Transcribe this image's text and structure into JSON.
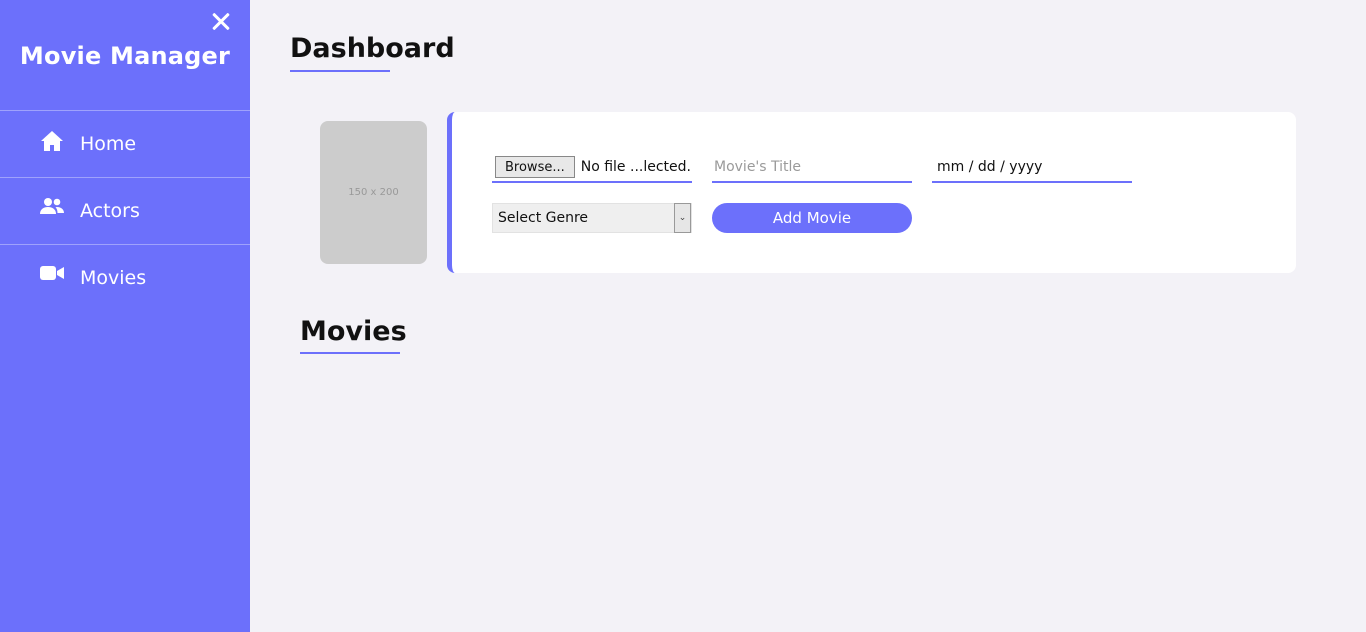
{
  "sidebar": {
    "brand": "Movie Manager",
    "items": [
      {
        "label": "Home",
        "icon": "home-icon"
      },
      {
        "label": "Actors",
        "icon": "users-icon"
      },
      {
        "label": "Movies",
        "icon": "video-camera-icon"
      }
    ]
  },
  "main": {
    "title": "Dashboard",
    "poster_placeholder": "150 x 200",
    "form": {
      "browse_label": "Browse...",
      "file_status": "No file ...lected.",
      "title_placeholder": "Movie's Title",
      "date_value": "mm / dd / yyyy",
      "genre_selected": "Select Genre",
      "add_button": "Add Movie"
    },
    "movies_title": "Movies"
  },
  "colors": {
    "accent": "#6c70fb",
    "background": "#f3f2f7",
    "card": "#ffffff"
  }
}
